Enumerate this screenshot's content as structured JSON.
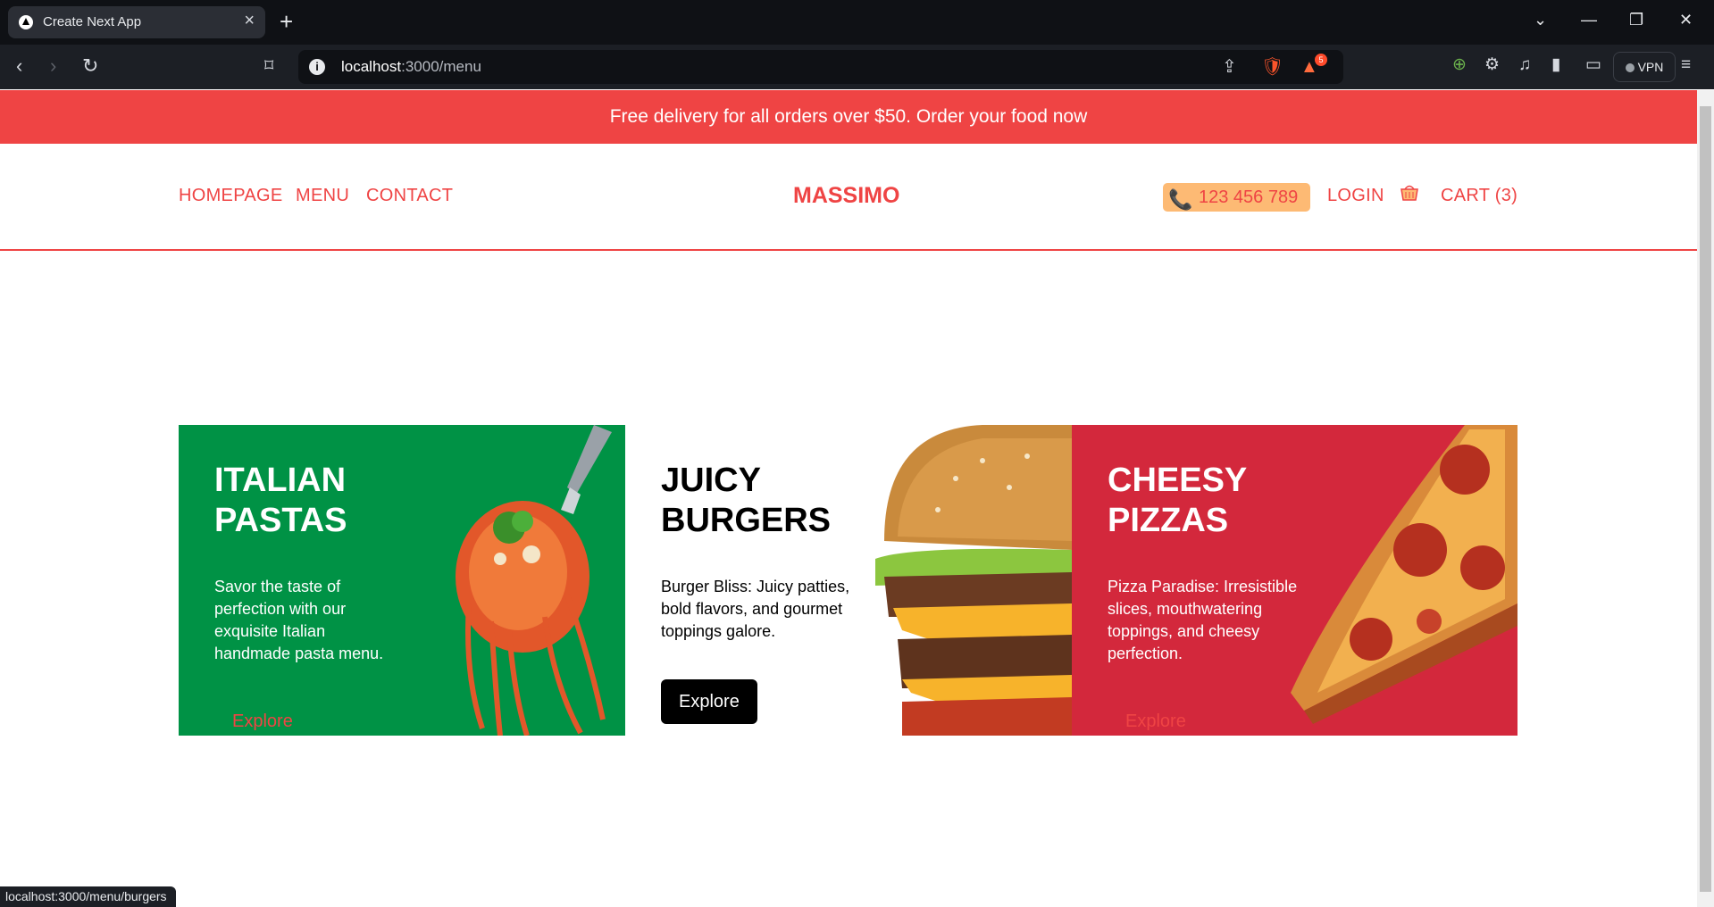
{
  "browser": {
    "tab_title": "Create Next App",
    "url_host": "localhost",
    "url_rest": ":3000/menu",
    "vpn_label": "VPN",
    "badge_count": "5",
    "status_url": "localhost:3000/menu/burgers"
  },
  "announcement": "Free delivery for all orders over $50. Order your food now",
  "nav": {
    "homepage": "HOMEPAGE",
    "menu": "MENU",
    "contact": "CONTACT",
    "logo": "MASSIMO",
    "phone": "123 456 789",
    "login": "LOGIN",
    "cart": "CART (3)"
  },
  "menu_cards": [
    {
      "title_line1": "ITALIAN",
      "title_line2": "PASTAS",
      "description": "Savor the taste of perfection with our exquisite Italian handmade pasta menu.",
      "button": "Explore",
      "bg": "#009245",
      "text_color": "#ffffff"
    },
    {
      "title_line1": "JUICY",
      "title_line2": "BURGERS",
      "description": "Burger Bliss: Juicy patties, bold flavors, and gourmet toppings galore.",
      "button": "Explore",
      "bg": "#ffffff",
      "text_color": "#000000"
    },
    {
      "title_line1": "CHEESY",
      "title_line2": "PIZZAS",
      "description": "Pizza Paradise: Irresistible slices, mouthwatering toppings, and cheesy perfection.",
      "button": "Explore",
      "bg": "#d3283c",
      "text_color": "#ffffff"
    }
  ],
  "colors": {
    "accent": "#ef4444",
    "phone_pill": "#fdba74"
  }
}
